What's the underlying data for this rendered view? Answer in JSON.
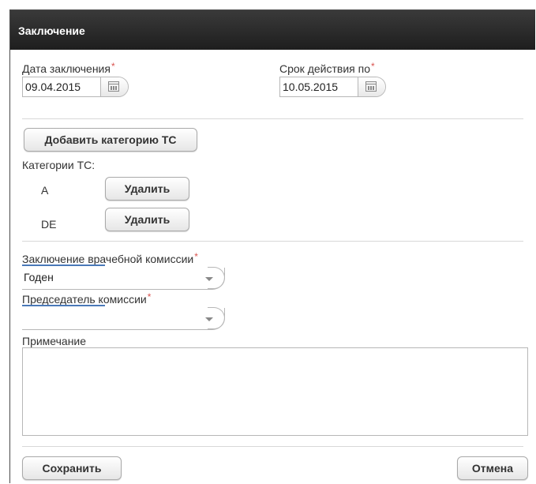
{
  "dialog": {
    "title": "Заключение"
  },
  "dates": {
    "conclusion_date_label": "Дата заключения",
    "conclusion_date_value": "09.04.2015",
    "valid_until_label": "Срок действия по",
    "valid_until_value": "10.05.2015",
    "required_mark": "*"
  },
  "categories": {
    "add_button": "Добавить категорию ТС",
    "list_label": "Категории ТС:",
    "items": [
      {
        "name": "A",
        "delete_label": "Удалить"
      },
      {
        "name": "DE",
        "delete_label": "Удалить"
      }
    ]
  },
  "commission": {
    "conclusion_label": "Заключение врачебной комиссии",
    "conclusion_value": "Годен",
    "chairman_label": "Председатель комиссии",
    "chairman_value": ""
  },
  "note": {
    "label": "Примечание",
    "value": ""
  },
  "footer": {
    "save_label": "Сохранить",
    "cancel_label": "Отмена"
  },
  "icons": {
    "date_picker": "calendar-icon",
    "dropdown": "chevron-down-icon"
  },
  "colors": {
    "titlebar": "#1e1e1e",
    "required": "#d9534f",
    "focus": "#4a79b8"
  }
}
